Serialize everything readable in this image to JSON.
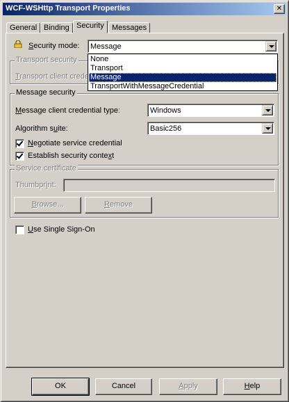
{
  "window": {
    "title": "WCF-WSHttp Transport Properties",
    "close_glyph": "✕"
  },
  "tabs": [
    {
      "label": "General"
    },
    {
      "label": "Binding"
    },
    {
      "label": "Security",
      "active": true
    },
    {
      "label": "Messages"
    }
  ],
  "security_mode": {
    "label_prefix": "Security mode",
    "label_u": "S",
    "label_rest": "ecurity mode:",
    "value": "Message",
    "icon": "lock-icon",
    "options": [
      "None",
      "Transport",
      "Message",
      "TransportWithMessageCredential"
    ],
    "selected_index": 2
  },
  "transport_security": {
    "legend": "Transport security",
    "client_credential_u": "T",
    "client_credential_rest": "ransport client crede"
  },
  "message_security": {
    "legend": "Message security",
    "client_cred_u": "M",
    "client_cred_rest": "essage client credential type:",
    "client_cred_value": "Windows",
    "algorithm_pre": "Algorithm s",
    "algorithm_u": "u",
    "algorithm_post": "ite:",
    "algorithm_value": "Basic256",
    "negotiate_pre": "",
    "negotiate_u": "N",
    "negotiate_post": "egotiate service credential",
    "negotiate_checked": true,
    "establish_pre": "Establish security conte",
    "establish_u": "x",
    "establish_post": "t",
    "establish_checked": true
  },
  "service_certificate": {
    "legend": "Service certificate",
    "thumbprint_pre": "Thumbpr",
    "thumbprint_u": "i",
    "thumbprint_post": "nt:",
    "thumbprint_value": "",
    "browse_pre": "",
    "browse_u": "B",
    "browse_post": "rowse...",
    "remove_pre": "",
    "remove_u": "R",
    "remove_post": "emove"
  },
  "sso": {
    "pre": "",
    "u": "U",
    "post": "se Single Sign-On",
    "checked": false
  },
  "buttons": {
    "ok": "OK",
    "cancel": "Cancel",
    "apply_u": "A",
    "apply_post": "pply",
    "help_u": "H",
    "help_post": "elp"
  },
  "colors": {
    "title_start": "#0a246a",
    "title_end": "#a6caf0",
    "face": "#d4d0c8",
    "selection": "#0a246a"
  }
}
